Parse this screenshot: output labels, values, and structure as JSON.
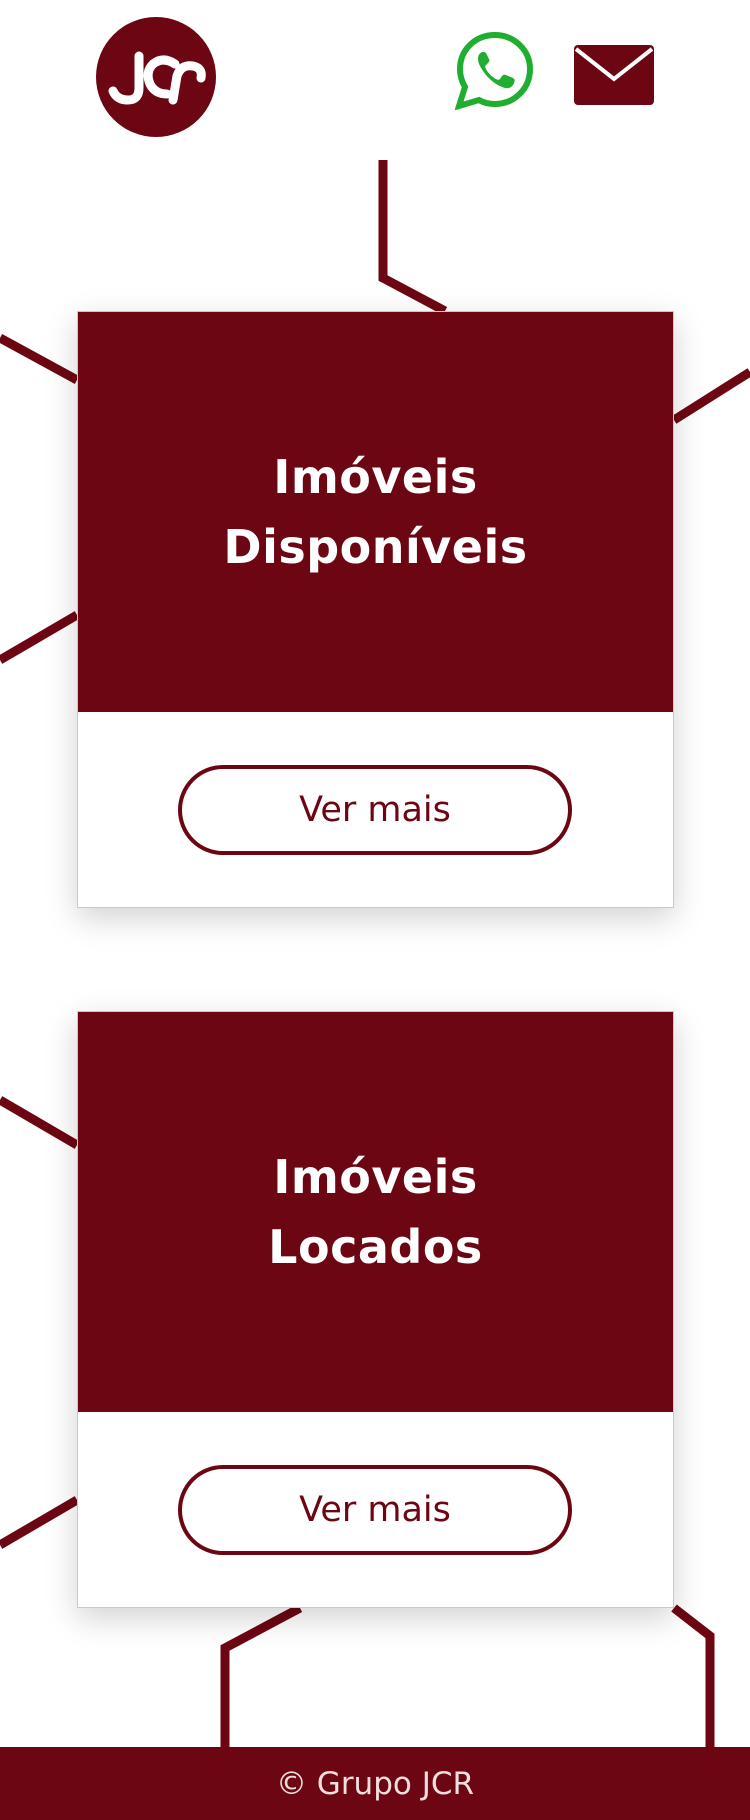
{
  "header": {
    "logo_text": "JCR",
    "whatsapp_icon": "whatsapp-icon",
    "mail_icon": "mail-icon"
  },
  "cards": [
    {
      "title_line1": "Imóveis",
      "title_line2": "Disponíveis",
      "button_label": "Ver mais"
    },
    {
      "title_line1": "Imóveis",
      "title_line2": "Locados",
      "button_label": "Ver mais"
    }
  ],
  "footer": {
    "text": "© Grupo JCR"
  },
  "colors": {
    "brand": "#6d0613",
    "whatsapp": "#1fae2f",
    "background": "#ffffff"
  }
}
